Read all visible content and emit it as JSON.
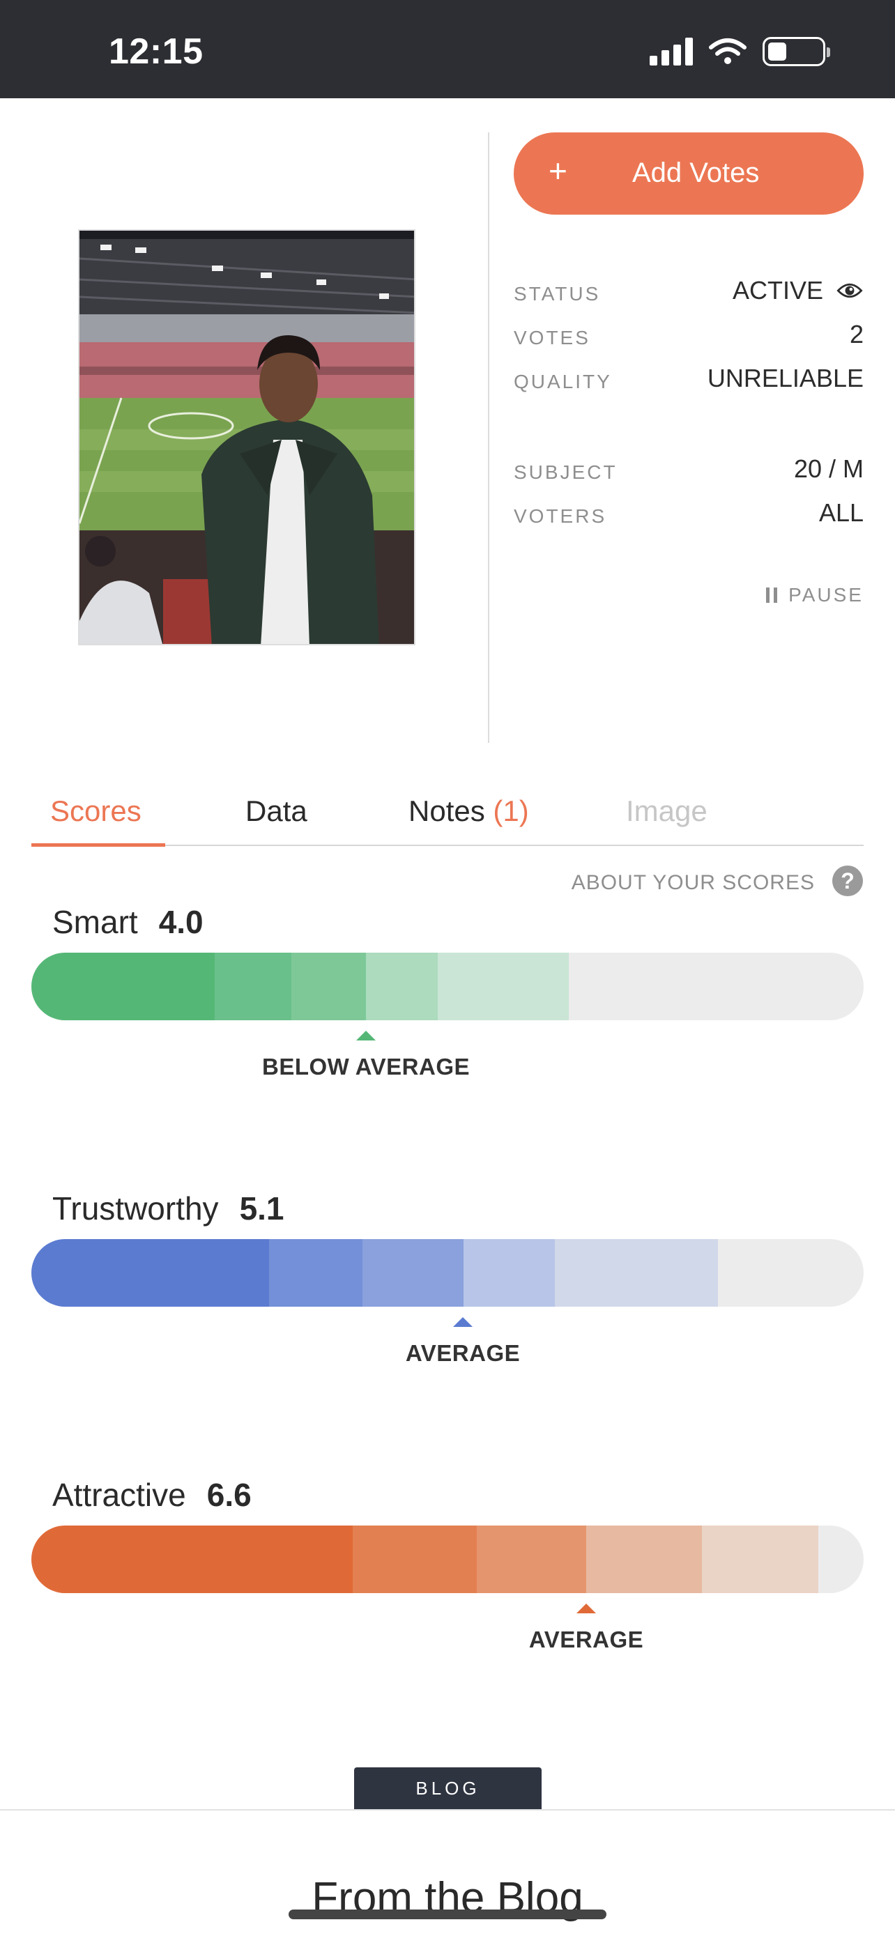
{
  "status_bar": {
    "time": "12:15"
  },
  "actions": {
    "add_votes_plus": "+",
    "add_votes_label": "Add Votes",
    "pause_label": "PAUSE"
  },
  "info": {
    "status": {
      "label": "STATUS",
      "value": "ACTIVE"
    },
    "votes": {
      "label": "VOTES",
      "value": "2"
    },
    "quality": {
      "label": "QUALITY",
      "value": "UNRELIABLE"
    },
    "subject": {
      "label": "SUBJECT",
      "value": "20 / M"
    },
    "voters": {
      "label": "VOTERS",
      "value": "ALL"
    }
  },
  "tabs": {
    "scores": "Scores",
    "data": "Data",
    "notes": "Notes",
    "notes_count": "(1)",
    "image": "Image"
  },
  "about_scores": "ABOUT YOUR SCORES",
  "help_icon_glyph": "?",
  "scores": [
    {
      "label": "Smart",
      "value": "4.0",
      "rating": "BELOW AVERAGE",
      "color": "#55b776"
    },
    {
      "label": "Trustworthy",
      "value": "5.1",
      "rating": "AVERAGE",
      "color": "#5b7bd1"
    },
    {
      "label": "Attractive",
      "value": "6.6",
      "rating": "AVERAGE",
      "color": "#e06a37"
    }
  ],
  "blog": {
    "tag": "BLOG",
    "title": "From the Blog"
  },
  "colors": {
    "accent": "#ec7653",
    "status_bar": "#2d2e33",
    "blog_tag": "#2f3441"
  }
}
